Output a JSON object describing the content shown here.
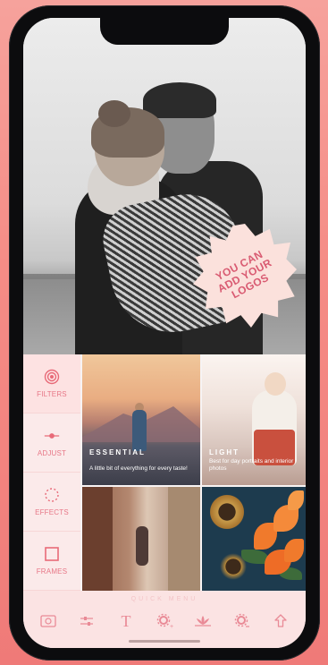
{
  "badge": {
    "line1": "YOU CAN",
    "line2": "ADD YOUR",
    "line3": "LOGOS"
  },
  "tools": [
    {
      "label": "FILTERS",
      "icon": "filters-icon"
    },
    {
      "label": "ADJUST",
      "icon": "adjust-slider-icon"
    },
    {
      "label": "EFFECTS",
      "icon": "effects-icon"
    },
    {
      "label": "FRAMES",
      "icon": "frames-icon"
    }
  ],
  "filters": [
    {
      "title": "ESSENTIAL",
      "subtitle": "A little bit of everything for every taste!"
    },
    {
      "title": "LIGHT",
      "subtitle": "Best for day portraits and interior photos"
    }
  ],
  "quick_menu": {
    "label": "QUICK MENU",
    "icons": [
      "photo-icon",
      "sliders-icon",
      "text-icon",
      "gear-plus-icon",
      "lotus-icon",
      "gear-minus-icon",
      "share-icon"
    ]
  },
  "colors": {
    "accent": "#e86a78",
    "background": "#f58c86"
  }
}
